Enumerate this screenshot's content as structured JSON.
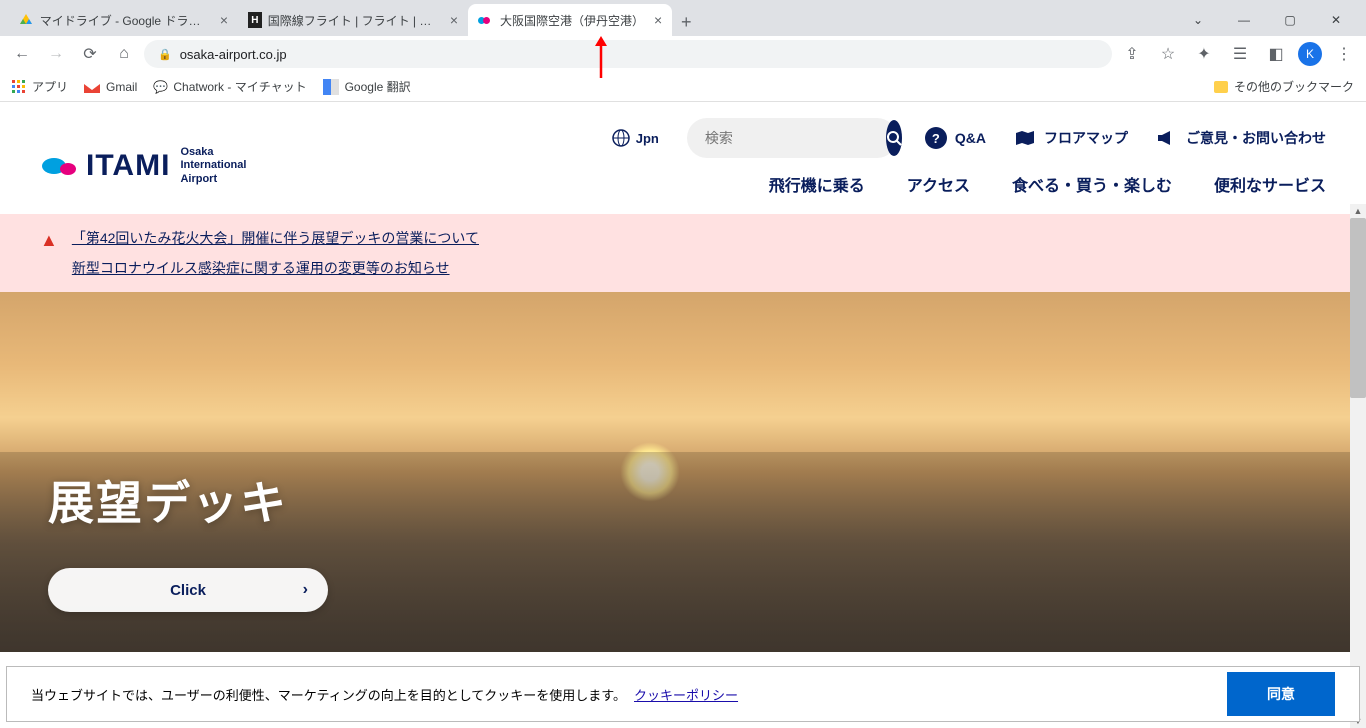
{
  "tabs": [
    {
      "title": "マイドライブ - Google ドライブ"
    },
    {
      "title": "国際線フライト | フライト | 羽田空港"
    },
    {
      "title": "大阪国際空港（伊丹空港）"
    }
  ],
  "url": "osaka-airport.co.jp",
  "bookmarks": {
    "apps": "アプリ",
    "gmail": "Gmail",
    "chatwork": "Chatwork - マイチャット",
    "translate": "Google 翻訳",
    "other": "その他のブックマーク"
  },
  "logo": {
    "main": "ITAMI",
    "sub1": "Osaka",
    "sub2": "International",
    "sub3": "Airport"
  },
  "lang": "Jpn",
  "search": {
    "placeholder": "検索"
  },
  "utils": {
    "qa": "Q&A",
    "map": "フロアマップ",
    "contact": "ご意見・お問い合わせ"
  },
  "nav": {
    "flight": "飛行機に乗る",
    "access": "アクセス",
    "dine": "食べる・買う・楽しむ",
    "service": "便利なサービス"
  },
  "alerts": {
    "a1": "「第42回いたみ花火大会」開催に伴う展望デッキの営業について",
    "a2": "新型コロナウイルス感染症に関する運用の変更等のお知らせ"
  },
  "hero": {
    "title": "展望デッキ",
    "cta": "Click"
  },
  "cookie": {
    "text": "当ウェブサイトでは、ユーザーの利便性、マーケティングの向上を目的としてクッキーを使用します。",
    "link": "クッキーポリシー",
    "agree": "同意"
  },
  "avatar": "K"
}
